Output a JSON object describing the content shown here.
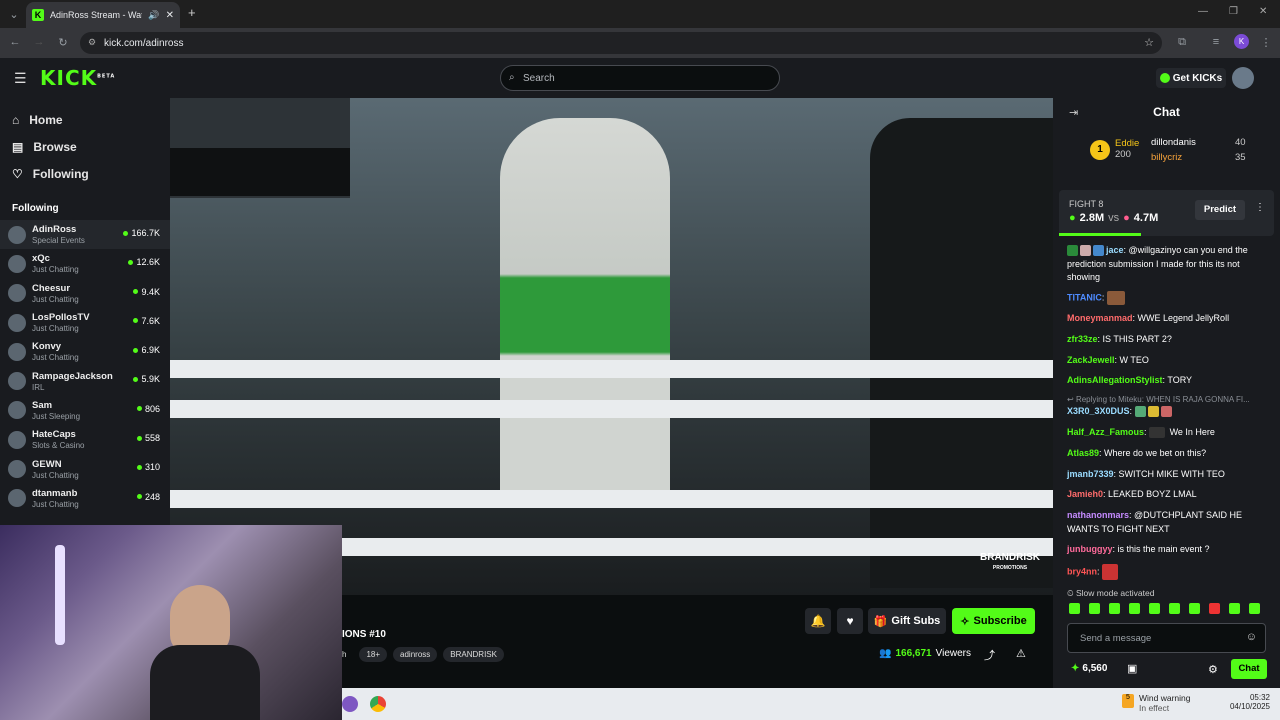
{
  "browser": {
    "tab_title": "AdinRoss Stream - Watch L",
    "url": "kick.com/adinross",
    "profile_initial": "K"
  },
  "header": {
    "logo": "KICK",
    "logo_badge": "BETA",
    "search_placeholder": "Search",
    "get_kicks": "Get KICKs"
  },
  "sidebar": {
    "nav": [
      {
        "label": "Home"
      },
      {
        "label": "Browse"
      },
      {
        "label": "Following"
      }
    ],
    "following_heading": "Following",
    "channels": [
      {
        "name": "AdinRoss",
        "category": "Special Events",
        "viewers": "166.7K"
      },
      {
        "name": "xQc",
        "category": "Just Chatting",
        "viewers": "12.6K"
      },
      {
        "name": "Cheesur",
        "category": "Just Chatting",
        "viewers": "9.4K"
      },
      {
        "name": "LosPollosTV",
        "category": "Just Chatting",
        "viewers": "7.6K"
      },
      {
        "name": "Konvy",
        "category": "Just Chatting",
        "viewers": "6.9K"
      },
      {
        "name": "RampageJackson",
        "category": "IRL",
        "viewers": "5.9K"
      },
      {
        "name": "Sam",
        "category": "Just Sleeping",
        "viewers": "806"
      },
      {
        "name": "HateCaps",
        "category": "Slots & Casino",
        "viewers": "558"
      },
      {
        "name": "GEWN",
        "category": "Just Chatting",
        "viewers": "310"
      },
      {
        "name": "dtanmanb",
        "category": "Just Chatting",
        "viewers": "248"
      }
    ]
  },
  "stream": {
    "title_fragment": "IONS #10",
    "tag_fragment": "h",
    "tags": [
      "18+",
      "adinross",
      "BRANDRISK"
    ],
    "viewers": "166,671",
    "viewers_label": "Viewers",
    "gift_subs": "Gift Subs",
    "subscribe": "Subscribe",
    "watermark": "BRANDRISK",
    "watermark_sub": "PROMOTIONS"
  },
  "chat": {
    "title": "Chat",
    "leaderboard": [
      {
        "rank": "1",
        "name": "Eddie",
        "score": "200"
      },
      {
        "name": "dillondanis",
        "score": "40"
      },
      {
        "name": "billycriz",
        "score": "35"
      }
    ],
    "prediction": {
      "label": "FIGHT 8",
      "left": "2.8M",
      "vs": "vs",
      "right": "4.7M",
      "button": "Predict"
    },
    "messages": [
      {
        "user": "jace",
        "color": "#9bdcff",
        "text": "@willgazinyo can you end the prediction submission I made for this its not showing"
      },
      {
        "user": "TITANIC",
        "color": "#4e8bff",
        "text": ""
      },
      {
        "user": "Moneymanmad",
        "color": "#ff6b6b",
        "text": "WWE Legend JellyRoll"
      },
      {
        "user": "zfr33ze",
        "color": "#53fc18",
        "text": "IS THIS PART 2?"
      },
      {
        "user": "ZackJewell",
        "color": "#53fc18",
        "text": "W TEO"
      },
      {
        "user": "AdinsAllegationStylist",
        "color": "#53fc18",
        "text": "TORY"
      },
      {
        "user": "X3R0_3X0DUS",
        "color": "#9bdcff",
        "text": ""
      },
      {
        "user": "Half_Azz_Famous",
        "color": "#53fc18",
        "text": "We In Here"
      },
      {
        "user": "Atlas89",
        "color": "#53fc18",
        "text": "Where do we bet on this?"
      },
      {
        "user": "jmanb7339",
        "color": "#9bdcff",
        "text": "SWITCH MIKE WITH TEO"
      },
      {
        "user": "Jamieh0",
        "color": "#ff6b6b",
        "text": "LEAKED BOYZ LMAL"
      },
      {
        "user": "nathanonmars",
        "color": "#c58bff",
        "text": "@DUTCHPLANT SAID HE WANTS TO FIGHT NEXT"
      },
      {
        "user": "junbuggyy",
        "color": "#ff6b9b",
        "text": "is this the main event ?"
      },
      {
        "user": "bry4nn",
        "color": "#ff5555",
        "text": ""
      }
    ],
    "reply_line": "Replying to Miteku: WHEN IS RAJA GONNA FI...",
    "slow_mode": "Slow mode activated",
    "input_placeholder": "Send a message",
    "points": "6,560",
    "send_button": "Chat"
  },
  "taskbar": {
    "weather_title": "Wind warning",
    "weather_sub": "In effect",
    "weather_badge": "5",
    "time": "05:32",
    "date": "04/10/2025"
  },
  "colors": {
    "brand": "#53fc18",
    "panel": "#191b1f",
    "background": "#0b0e0f"
  }
}
